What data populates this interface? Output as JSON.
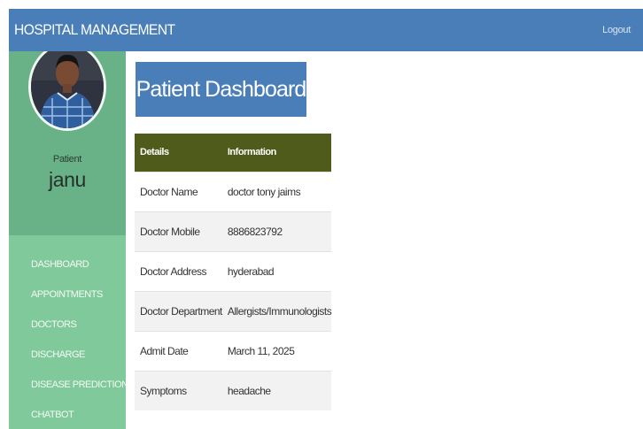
{
  "navbar": {
    "brand": "HOSPITAL MANAGEMENT",
    "logout": "Logout"
  },
  "sidebar": {
    "role": "Patient",
    "username": "janu",
    "menu": [
      {
        "label": "DASHBOARD"
      },
      {
        "label": "APPOINTMENTS"
      },
      {
        "label": "DOCTORS"
      },
      {
        "label": "DISCHARGE"
      },
      {
        "label": "DISEASE PREDICTION"
      },
      {
        "label": "CHATBOT"
      }
    ]
  },
  "main": {
    "title": "Patient Dashboard",
    "table": {
      "headers": [
        "Details",
        "Information"
      ],
      "rows": [
        [
          "Doctor Name",
          "doctor tony jaims"
        ],
        [
          "Doctor Mobile",
          "8886823792"
        ],
        [
          "Doctor Address",
          "hyderabad"
        ],
        [
          "Doctor Department",
          "Allergists/Immunologists"
        ],
        [
          "Admit Date",
          "March 11, 2025"
        ],
        [
          "Symptoms",
          "headache"
        ]
      ]
    }
  },
  "colors": {
    "navbar": "#4a7eb8",
    "sidebar": "#7fc99a",
    "profile_panel": "#69b287",
    "table_header": "#4e5b1a"
  }
}
